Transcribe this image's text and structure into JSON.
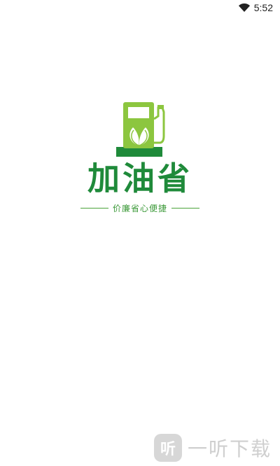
{
  "status_bar": {
    "time": "5:52",
    "icons": [
      "wifi-icon"
    ]
  },
  "splash": {
    "app_name": "加油省",
    "tagline": "价廉省心便捷",
    "logo_icon": "fuel-pump-leaf-icon",
    "brand_colors": {
      "dark_green": "#1f8a3a",
      "light_green": "#8cc63f"
    }
  },
  "watermark": {
    "icon_char": "听",
    "text": "一听下载"
  }
}
